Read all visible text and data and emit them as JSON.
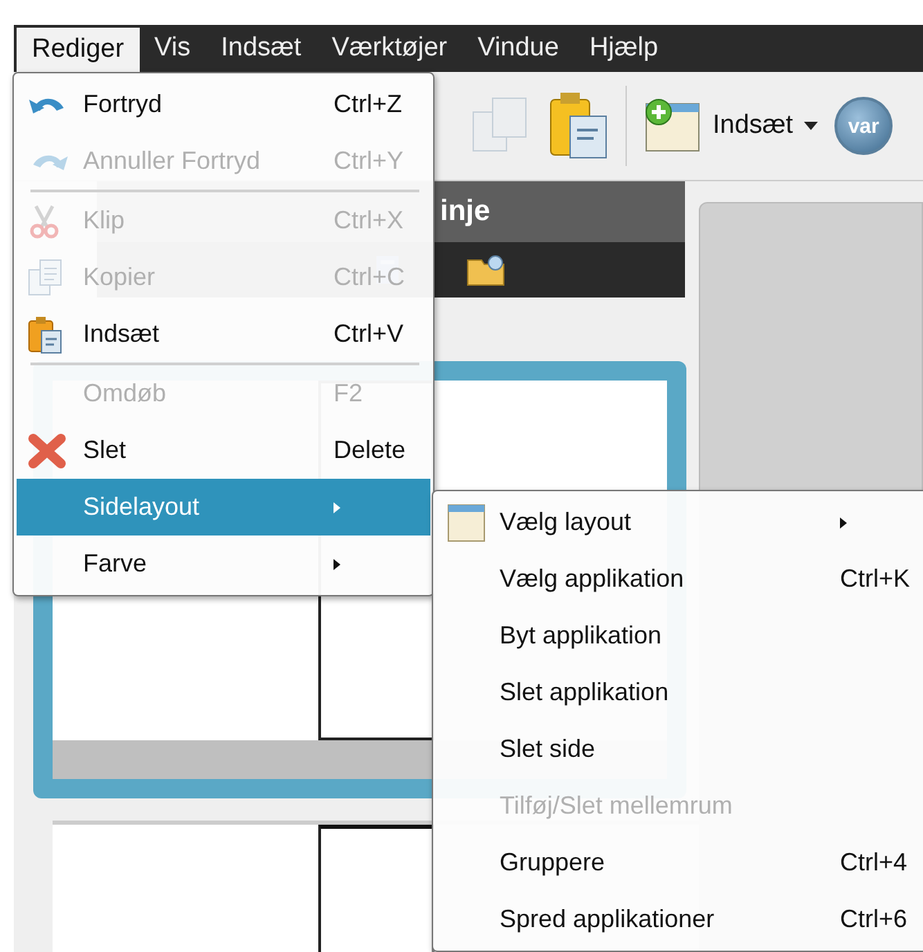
{
  "menubar": [
    {
      "label": "Rediger",
      "selected": true
    },
    {
      "label": "Vis",
      "selected": false
    },
    {
      "label": "Indsæt",
      "selected": false
    },
    {
      "label": "Værktøjer",
      "selected": false
    },
    {
      "label": "Vindue",
      "selected": false
    },
    {
      "label": "Hjælp",
      "selected": false
    }
  ],
  "toolbar": {
    "insert_button": "Indsæt",
    "variable_button": "var"
  },
  "document_panel": {
    "title": "inje"
  },
  "edit_menu": [
    {
      "kind": "item",
      "label": "Fortryd",
      "shortcut": "Ctrl+Z",
      "disabled": false,
      "selected": false
    },
    {
      "kind": "item",
      "label": "Annuller Fortryd",
      "shortcut": "Ctrl+Y",
      "disabled": true,
      "selected": false
    },
    {
      "kind": "separator"
    },
    {
      "kind": "item",
      "label": "Klip",
      "shortcut": "Ctrl+X",
      "disabled": true,
      "selected": false
    },
    {
      "kind": "item",
      "label": "Kopier",
      "shortcut": "Ctrl+C",
      "disabled": true,
      "selected": false
    },
    {
      "kind": "item",
      "label": "Indsæt",
      "shortcut": "Ctrl+V",
      "disabled": false,
      "selected": false
    },
    {
      "kind": "separator"
    },
    {
      "kind": "item",
      "label": "Omdøb",
      "shortcut": "F2",
      "disabled": true,
      "selected": false
    },
    {
      "kind": "item",
      "label": "Slet",
      "shortcut": "Delete",
      "disabled": false,
      "selected": false
    },
    {
      "kind": "submenu",
      "label": "Sidelayout",
      "disabled": false,
      "selected": true
    },
    {
      "kind": "submenu",
      "label": "Farve",
      "disabled": false,
      "selected": false
    }
  ],
  "page_layout_menu": [
    {
      "kind": "submenu",
      "label": "Vælg layout",
      "disabled": false
    },
    {
      "kind": "item",
      "label": "Vælg applikation",
      "shortcut": "Ctrl+K",
      "disabled": false
    },
    {
      "kind": "item",
      "label": "Byt applikation",
      "disabled": false
    },
    {
      "kind": "item",
      "label": "Slet applikation",
      "disabled": false
    },
    {
      "kind": "item",
      "label": "Slet side",
      "disabled": false
    },
    {
      "kind": "item",
      "label": "Tilføj/Slet mellemrum",
      "disabled": true
    },
    {
      "kind": "item",
      "label": "Gruppere",
      "shortcut": "Ctrl+4",
      "disabled": false
    },
    {
      "kind": "item",
      "label": "Spred applikationer",
      "shortcut": "Ctrl+6",
      "disabled": false
    }
  ]
}
